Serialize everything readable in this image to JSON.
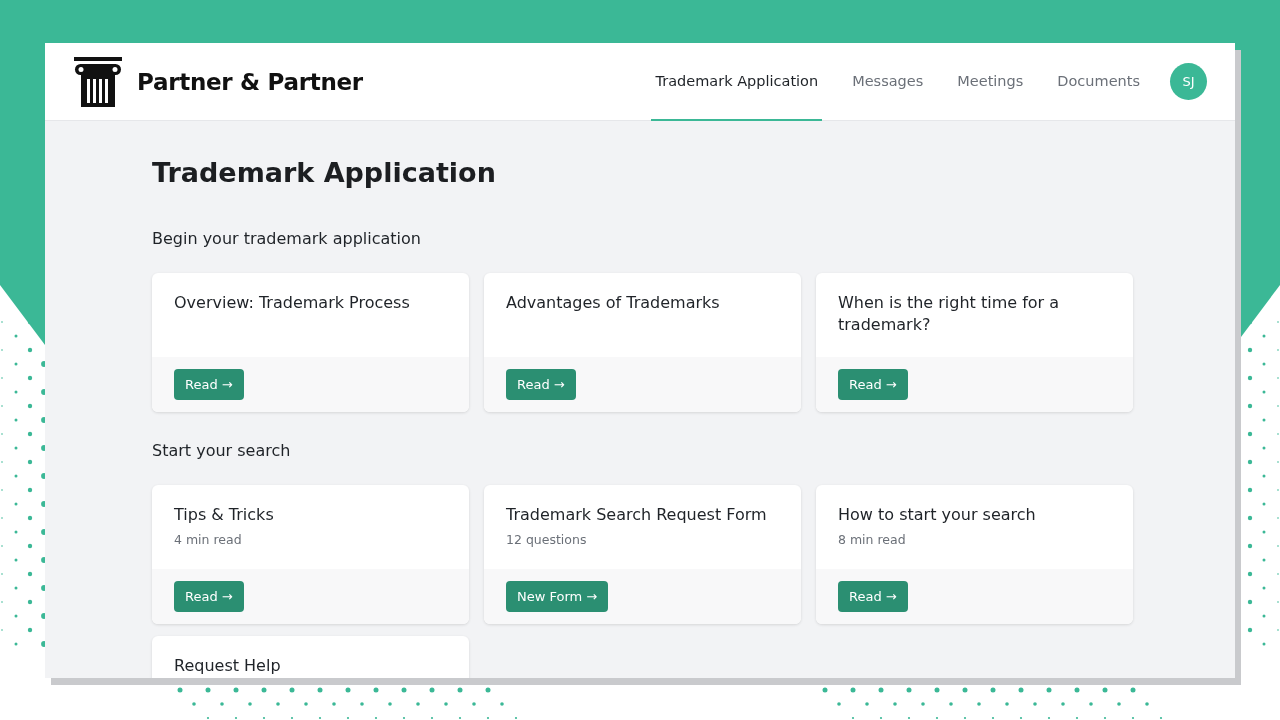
{
  "brand": {
    "name": "Partner & Partner"
  },
  "nav": [
    {
      "label": "Trademark Application",
      "selected": true
    },
    {
      "label": "Messages",
      "selected": false
    },
    {
      "label": "Meetings",
      "selected": false
    },
    {
      "label": "Documents",
      "selected": false
    }
  ],
  "avatar": {
    "initials": "SJ"
  },
  "page_title": "Trademark Application",
  "sections": [
    {
      "heading": "Begin your trademark application",
      "cards": [
        {
          "title": "Overview: Trademark Process",
          "button": "Read →"
        },
        {
          "title": "Advantages of Trademarks",
          "button": "Read →"
        },
        {
          "title": "When is the right time for a trademark?",
          "button": "Read →"
        }
      ]
    },
    {
      "heading": "Start your search",
      "cards": [
        {
          "title": "Tips & Tricks",
          "meta": "4 min read",
          "button": "Read →"
        },
        {
          "title": "Trademark Search Request Form",
          "meta": "12 questions",
          "button": "New Form →"
        },
        {
          "title": "How to start your search",
          "meta": "8 min read",
          "button": "Read →"
        },
        {
          "title": "Request Help"
        }
      ]
    }
  ]
}
